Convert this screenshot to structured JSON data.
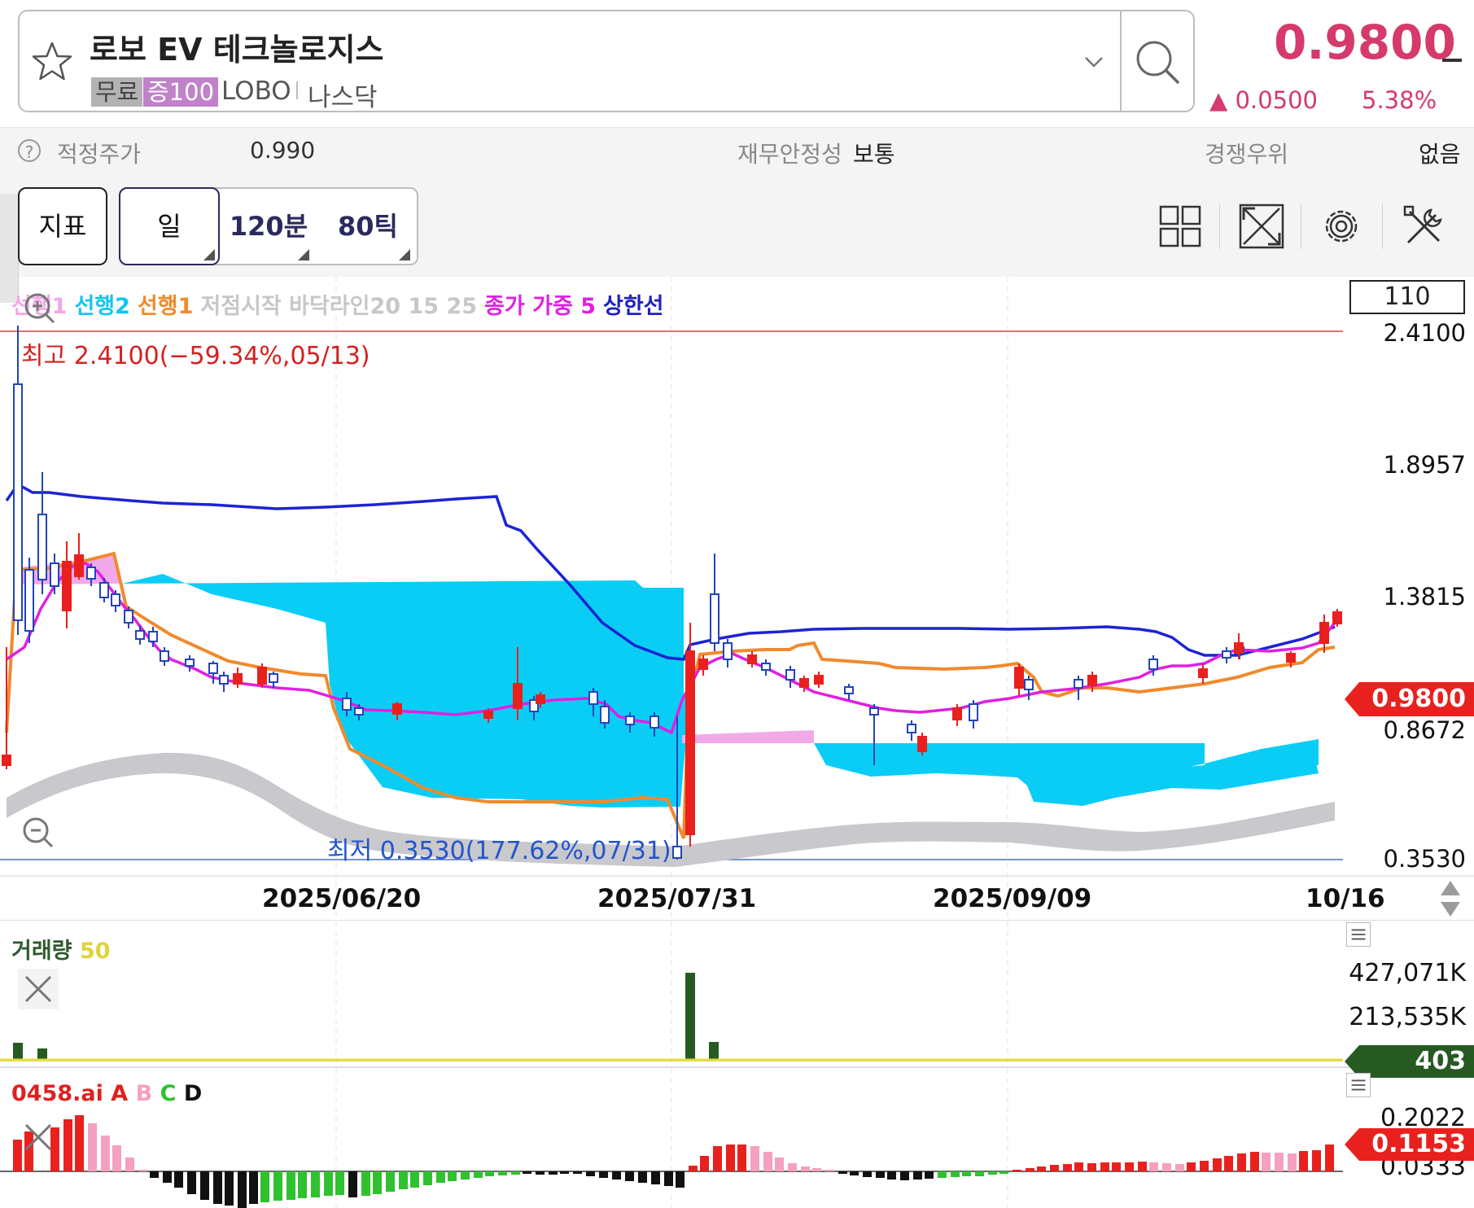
{
  "header": {
    "stock_name": "로보 EV 테크놀로지스",
    "tag_free": "무료",
    "tag_margin": "증100",
    "ticker": "LOBO",
    "market": "나스닥",
    "price": "0.9800",
    "change": "▲ 0.0500",
    "change_pct": "5.38%",
    "price_color": "#d53a6b"
  },
  "info_bar": {
    "fair_price_label": "적정주가",
    "fair_price_value": "0.990",
    "financial_stability_label": "재무안정성",
    "financial_stability_value": "보통",
    "competitive_edge_label": "경쟁우위",
    "competitive_edge_value": "없음"
  },
  "toolbar": {
    "indicator_label": "지표",
    "period_day": "일",
    "period_120min": "120분",
    "period_80tick": "80틱"
  },
  "legend": {
    "items": [
      {
        "label": "선행1",
        "color": "#f4a6e8"
      },
      {
        "label": "선행2",
        "color": "#13c5f0"
      },
      {
        "label": "선행1",
        "color": "#f08a2c"
      },
      {
        "label": "저점시작 바닥라인20 15 25",
        "color": "#c7c7c7"
      },
      {
        "label": "종가 가중 5",
        "color": "#e020e0"
      },
      {
        "label": "상한선",
        "color": "#2020c0"
      }
    ],
    "box_value": "110"
  },
  "price_axis": [
    "2.4100",
    "1.8957",
    "1.3815",
    "0.8672",
    "0.3530"
  ],
  "date_axis": [
    "2025/06/20",
    "2025/07/31",
    "2025/09/09",
    "10/16"
  ],
  "annotations": {
    "high": "최고 2.4100(−59.34%,05/13)",
    "low": "최저 0.3530(177.62%,07/31)"
  },
  "current_price_tag": "0.9800",
  "volume": {
    "title": "거래량",
    "period": "50",
    "axis": [
      "427,071K",
      "213,535K"
    ],
    "current": "403"
  },
  "oscillator": {
    "title_prefix": "0458.ai",
    "letters": [
      {
        "label": "A",
        "color": "#e02020"
      },
      {
        "label": "B",
        "color": "#f5a0c0"
      },
      {
        "label": "C",
        "color": "#30c030"
      },
      {
        "label": "D",
        "color": "#111111"
      }
    ],
    "axis": [
      "0.2022",
      "0.0333"
    ],
    "current": "0.1153"
  }
}
